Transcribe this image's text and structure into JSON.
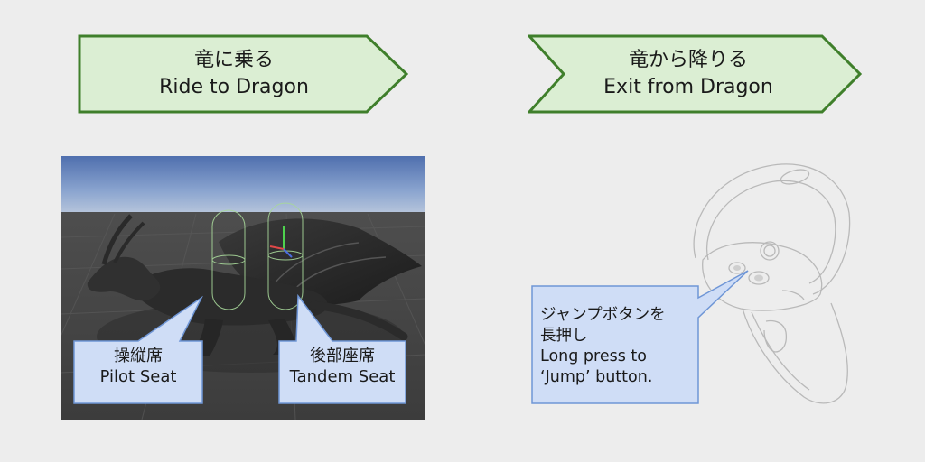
{
  "steps": {
    "ride": {
      "title_ja": "竜に乗る",
      "title_en": "Ride to Dragon"
    },
    "exit": {
      "title_ja": "竜から降りる",
      "title_en": "Exit from Dragon"
    }
  },
  "seats": {
    "pilot": {
      "label_ja": "操縦席",
      "label_en": "Pilot Seat"
    },
    "tandem": {
      "label_ja": "後部座席",
      "label_en": "Tandem Seat"
    }
  },
  "jump_hint": {
    "line1": "ジャンプボタンを",
    "line2": "長押し",
    "line3": "Long press to",
    "line4": "‘Jump’ button."
  },
  "colors": {
    "chevron_fill": "#dbeed3",
    "chevron_stroke": "#3f7f2b",
    "callout_fill": "#cfddf6",
    "callout_stroke": "#6f96d6",
    "background": "#ededed"
  }
}
